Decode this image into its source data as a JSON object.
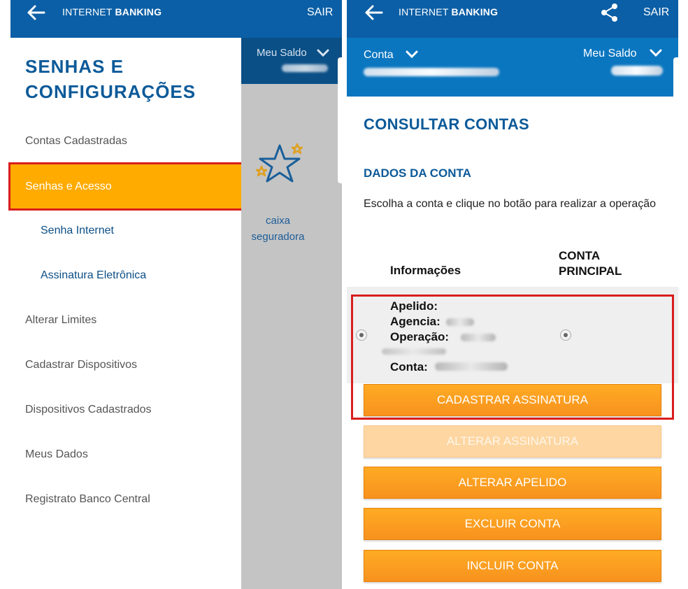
{
  "left": {
    "header": {
      "brand_light": "INTERNET",
      "brand_bold": "BANKING",
      "logout": "SAIR"
    },
    "title_line1": "SENHAS E",
    "title_line2": "CONFIGURAÇÕES",
    "balance_label": "Meu Saldo",
    "menu": [
      "Contas Cadastradas",
      "Senhas e Acesso",
      "Senha Internet",
      "Assinatura Eletrônica",
      "Alterar Limites",
      "Cadastrar Dispositivos",
      "Dispositivos Cadastrados",
      "Meus Dados",
      "Registrato Banco Central"
    ],
    "tile": {
      "line1": "caixa",
      "line2": "seguradora"
    }
  },
  "right": {
    "header": {
      "brand_light": "INTERNET",
      "brand_bold": "BANKING",
      "logout": "SAIR"
    },
    "account_label": "Conta",
    "balance_label": "Meu Saldo",
    "page_title": "CONSULTAR CONTAS",
    "section_title": "DADOS DA CONTA",
    "instruction": "Escolha a conta e clique no botão para realizar a operação",
    "table": {
      "col_info": "Informações",
      "col_main_line1": "CONTA",
      "col_main_line2": "PRINCIPAL"
    },
    "account_fields": {
      "nickname": "Apelido:",
      "agency": "Agencia:",
      "operation": "Operação:",
      "account": "Conta:"
    },
    "buttons": {
      "register_signature": "CADASTRAR ASSINATURA",
      "change_signature": "ALTERAR ASSINATURA",
      "change_nickname": "ALTERAR APELIDO",
      "delete_account": "EXCLUIR CONTA",
      "add_account": "INCLUIR CONTA"
    }
  },
  "colors": {
    "header_blue": "#0b5fa6",
    "title_blue": "#0c5a99",
    "highlight_orange": "#ffab00",
    "annotation_red": "#d81e1e",
    "button_orange": "#f7921e"
  }
}
